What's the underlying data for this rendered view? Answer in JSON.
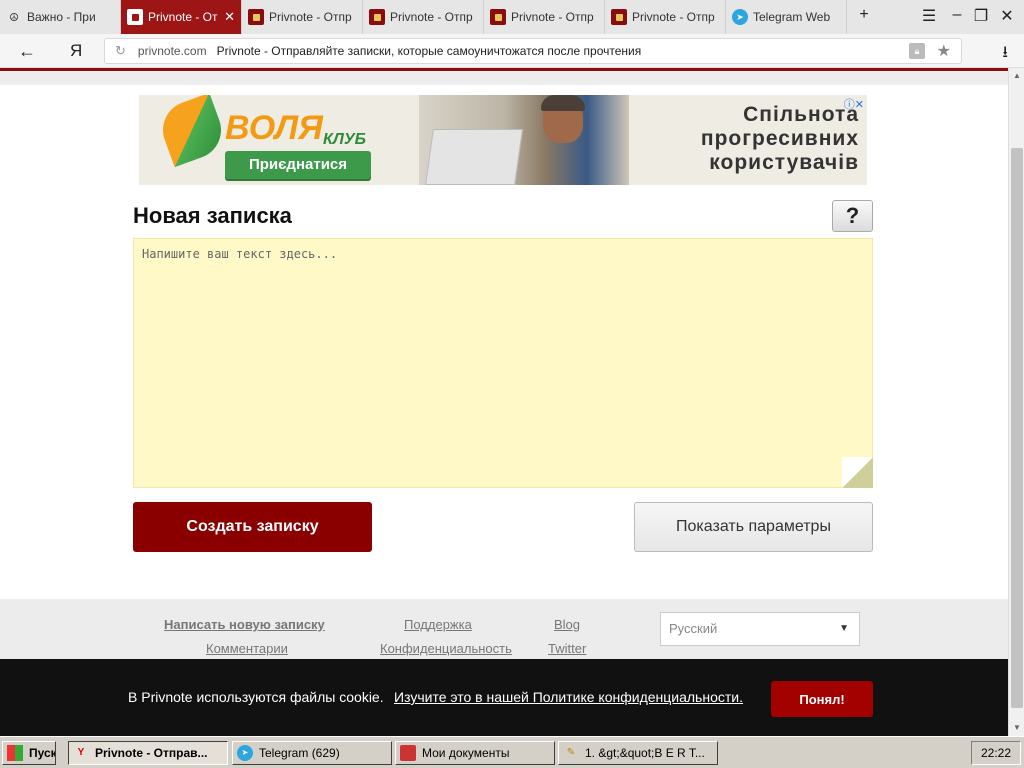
{
  "browser": {
    "tabs": [
      {
        "title": "Важно - При",
        "icon": "peace-icon"
      },
      {
        "title": "Privnote - От",
        "icon": "privnote-icon",
        "active": true
      },
      {
        "title": "Privnote - Отпр",
        "icon": "privnote-icon"
      },
      {
        "title": "Privnote - Отпр",
        "icon": "privnote-icon"
      },
      {
        "title": "Privnote - Отпр",
        "icon": "privnote-icon"
      },
      {
        "title": "Privnote - Отпр",
        "icon": "privnote-icon"
      },
      {
        "title": "Telegram Web",
        "icon": "telegram-icon"
      }
    ],
    "new_tab": "+",
    "address": {
      "domain": "privnote.com",
      "page_title": "Privnote - Отправляйте записки, которые самоуничтожатся после прочтения"
    },
    "yandex_logo": "Я"
  },
  "ad": {
    "brand": "ВОЛЯ",
    "club": "КЛУБ",
    "join": "Приєднатися",
    "slogan_line1": "Спільнота",
    "slogan_line2": "прогресивних",
    "slogan_line3": "користувачів"
  },
  "note": {
    "heading": "Новая записка",
    "help": "?",
    "placeholder": "Напишите ваш текст здесь...",
    "create": "Создать записку",
    "options": "Показать параметры"
  },
  "footer": {
    "links": {
      "new_note": "Написать новую записку",
      "support": "Поддержка",
      "blog": "Blog",
      "comments": "Комментарии",
      "privacy": "Конфиденциальность",
      "twitter": "Twitter"
    },
    "language": "Русский"
  },
  "cookie": {
    "text": "В Privnote используются файлы cookie.",
    "link": "Изучите это в нашей Политике конфиденциальности.",
    "accept": "Понял!"
  },
  "taskbar": {
    "start": "Пуск",
    "items": [
      {
        "label": "Privnote - Отправ...",
        "icon": "yandex-icon",
        "active": true
      },
      {
        "label": "Telegram (629)",
        "icon": "telegram-icon"
      },
      {
        "label": "Мои документы",
        "icon": "folder-icon"
      },
      {
        "label": "1. &gt;&quot;B E R T...",
        "icon": "document-icon"
      }
    ],
    "clock": "22:22"
  },
  "colors": {
    "brand_red": "#8a0000",
    "note_yellow": "#fff9c8",
    "cookie_bar": "#111111"
  }
}
